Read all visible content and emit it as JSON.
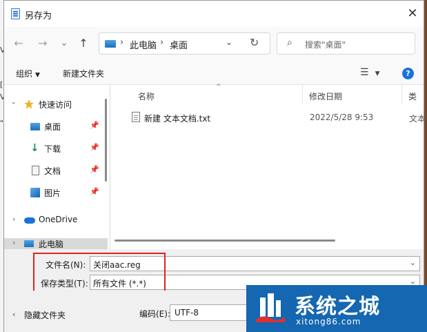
{
  "window": {
    "title": "另存为",
    "close_glyph": "✕"
  },
  "nav": {
    "back": "←",
    "forward": "→",
    "recent": "⌄",
    "up": "↑"
  },
  "address": {
    "crumbs": [
      "此电脑",
      "桌面"
    ],
    "separator": "›",
    "dropdown": "⌄",
    "refresh": "↻"
  },
  "search": {
    "placeholder": "搜索\"桌面\"",
    "icon": "⌕"
  },
  "toolbar": {
    "organize": "组织",
    "new_folder": "新建文件夹",
    "caret": "▼",
    "view_glyph": "☰",
    "help_glyph": "?"
  },
  "sidebar": {
    "quick_access": "快速访问",
    "items": [
      {
        "label": "桌面",
        "icon": "desktop-icon"
      },
      {
        "label": "下载",
        "icon": "download-icon"
      },
      {
        "label": "文档",
        "icon": "document-icon"
      },
      {
        "label": "图片",
        "icon": "picture-icon"
      }
    ],
    "onedrive": "OneDrive",
    "this_pc": "此电脑",
    "chevron": "›",
    "pin": "📌"
  },
  "columns": {
    "name": "名称",
    "date": "修改日期",
    "type": "类型",
    "sort_glyph": "^"
  },
  "files": [
    {
      "name": "新建 文本文档.txt",
      "date": "2022/5/28 9:53",
      "type": "文本文"
    }
  ],
  "form": {
    "filename_label": "文件名(N):",
    "filename_value": "关闭aac.reg",
    "type_label": "保存类型(T):",
    "type_value": "所有文件 (*.*)",
    "dropdown_glyph": "⌄"
  },
  "bottom": {
    "hide_folders": "隐藏文件夹",
    "hide_chevron": "‹",
    "encoding_label": "编码(E):",
    "encoding_value": "UTF-8"
  },
  "watermark": {
    "title": "系统之城",
    "url": "xitong86.com"
  },
  "background_fragments": [
    "V",
    "[",
    "V",
    "\""
  ],
  "colors": {
    "accent": "#1a73d9",
    "highlight_box": "#e02020",
    "watermark_bg": "#1467b0",
    "selected_bg": "#d9d9d9"
  }
}
